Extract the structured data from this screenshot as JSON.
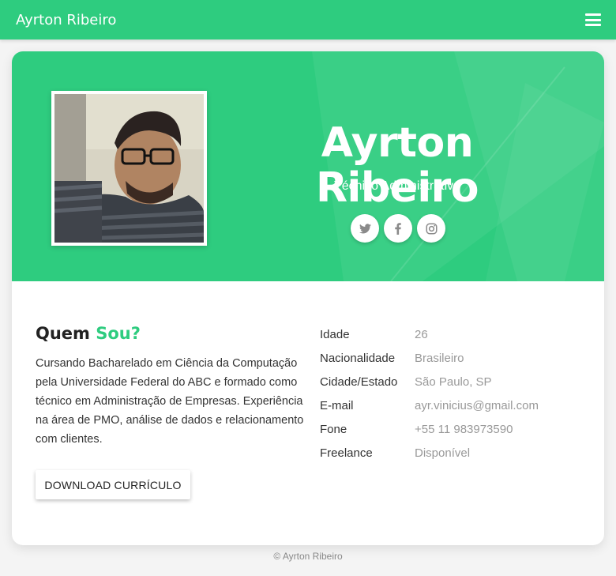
{
  "navbar": {
    "brand": "Ayrton Ribeiro",
    "menu_icon": "hamburger-menu-icon"
  },
  "hero": {
    "name": "Ayrton Ribeiro",
    "role": "Técnico Administrativo",
    "socials": [
      {
        "icon": "twitter-icon",
        "glyph": "🐦"
      },
      {
        "icon": "facebook-icon",
        "glyph": "f"
      },
      {
        "icon": "instagram-icon",
        "glyph": "◎"
      }
    ]
  },
  "about": {
    "title_main": "Quem",
    "title_accent": "Sou?",
    "text": "Cursando Bacharelado em Ciência da Computação pela Universidade Federal do ABC e formado como técnico em Administração de Empresas. Experiência na área de PMO, análise de dados e relacionamento com clientes.",
    "download_label": "DOWNLOAD CURRÍCULO"
  },
  "info": [
    {
      "label": "Idade",
      "value": "26"
    },
    {
      "label": "Nacionalidade",
      "value": "Brasileiro"
    },
    {
      "label": "Cidade/Estado",
      "value": "São Paulo, SP"
    },
    {
      "label": "E-mail",
      "value": "ayr.vinicius@gmail.com"
    },
    {
      "label": "Fone",
      "value": "+55 11 983973590"
    },
    {
      "label": "Freelance",
      "value": "Disponível"
    }
  ],
  "footer": "© Ayrton Ribeiro",
  "colors": {
    "accent": "#2ecc7f",
    "background": "#f4f4f4"
  }
}
